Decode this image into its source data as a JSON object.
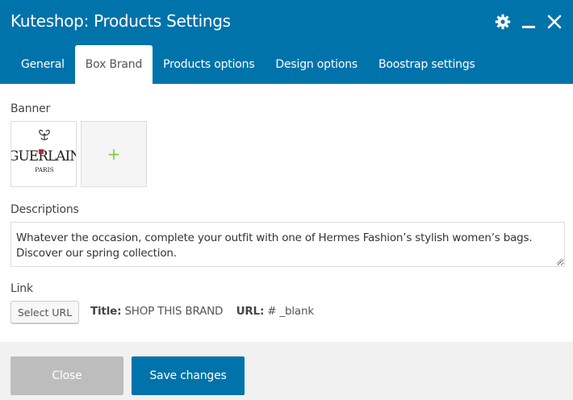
{
  "window": {
    "title": "Kuteshop: Products Settings",
    "icons": [
      "gear-icon",
      "minimize-icon",
      "close-icon"
    ]
  },
  "tabs": [
    {
      "label": "General",
      "active": false
    },
    {
      "label": "Box Brand",
      "active": true
    },
    {
      "label": "Products options",
      "active": false
    },
    {
      "label": "Design options",
      "active": false
    },
    {
      "label": "Boostrap settings",
      "active": false
    }
  ],
  "banner": {
    "label": "Banner",
    "image_logo": "GUERLAIN",
    "image_sub": "PARIS",
    "add_icon": "+"
  },
  "descriptions": {
    "label": "Descriptions",
    "value": "Whatever the occasion, complete your outfit with one of Hermes Fashion’s stylish women’s bags. Discover our spring collection."
  },
  "link": {
    "label": "Link",
    "select_label": "Select URL",
    "title_key": "Title:",
    "title_value": "SHOP THIS BRAND",
    "url_key": "URL:",
    "url_value": "# _blank"
  },
  "footer": {
    "close_label": "Close",
    "save_label": "Save changes"
  },
  "colors": {
    "accent": "#0073aa",
    "plus": "#7ad03a",
    "footer_bg": "#f1f1f1",
    "disabled_button": "#bdbdbd"
  }
}
